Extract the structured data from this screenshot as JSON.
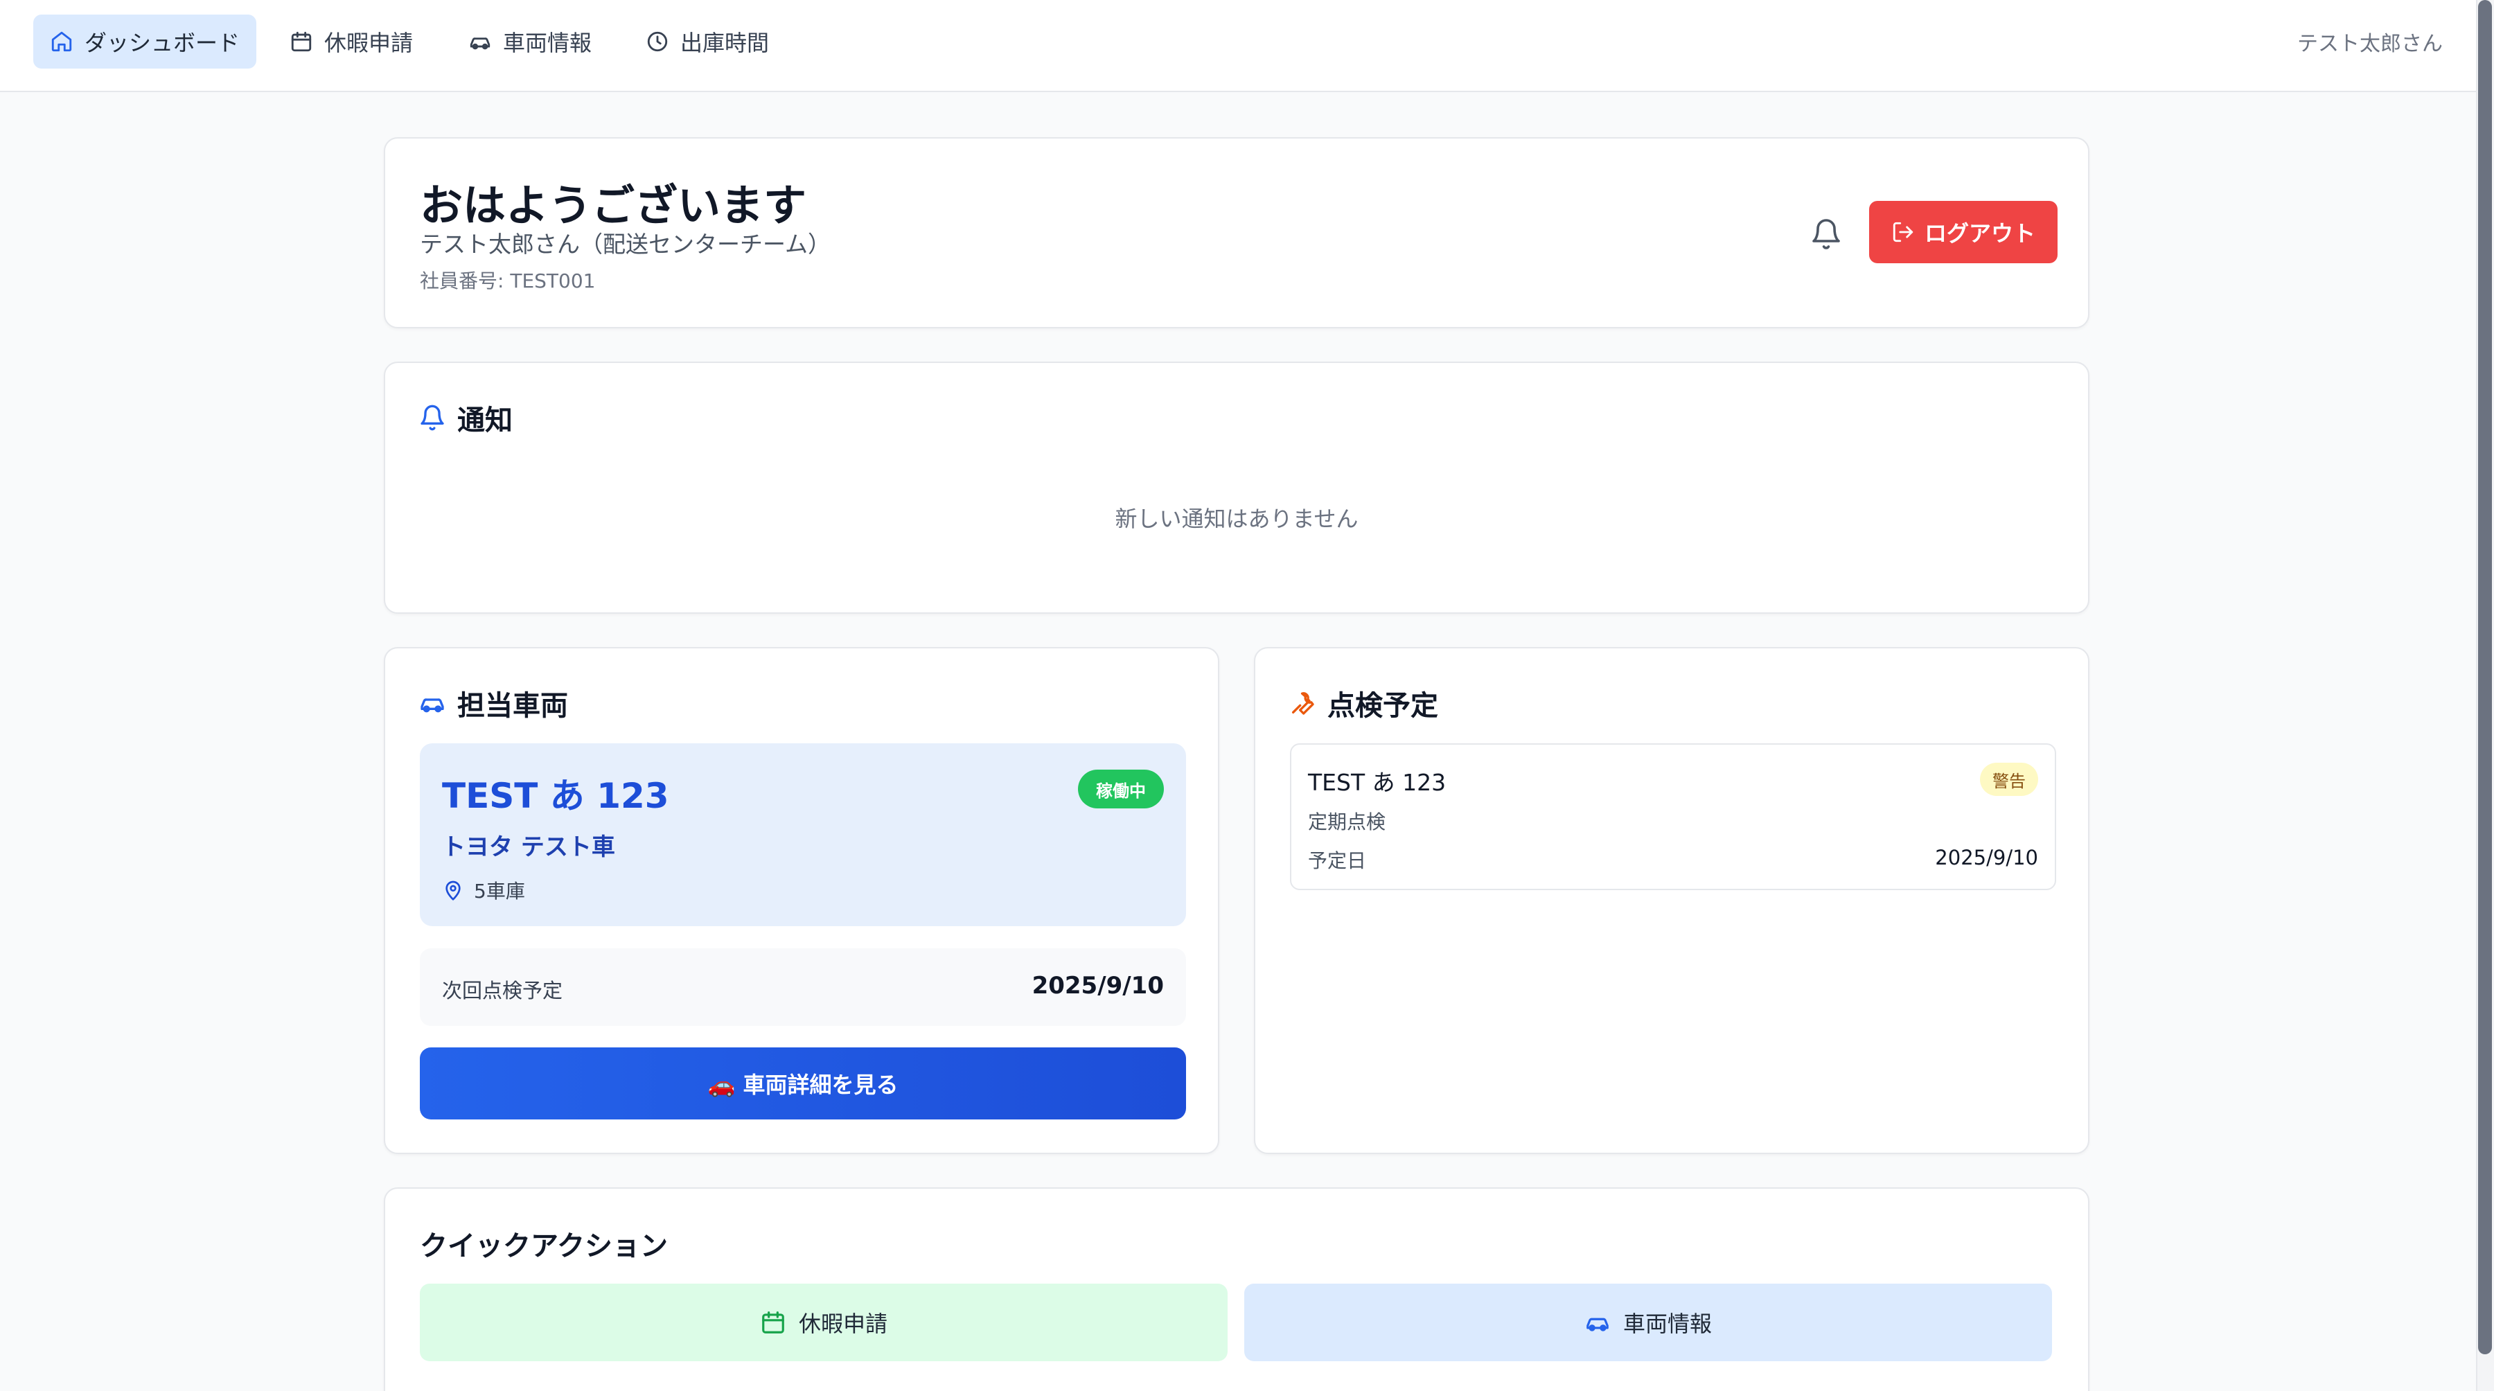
{
  "nav": {
    "items": [
      {
        "label": "ダッシュボード",
        "icon": "home-icon"
      },
      {
        "label": "休暇申請",
        "icon": "calendar-icon"
      },
      {
        "label": "車両情報",
        "icon": "car-icon"
      },
      {
        "label": "出庫時間",
        "icon": "clock-icon"
      }
    ],
    "user": "テスト太郎さん"
  },
  "greeting": {
    "title": "おはようございます",
    "subtitle": "テスト太郎さん（配送センターチーム）",
    "employee_id": "社員番号: TEST001",
    "logout_label": "ログアウト"
  },
  "notifications": {
    "title": "通知",
    "empty_message": "新しい通知はありません"
  },
  "vehicle": {
    "title": "担当車両",
    "plate": "TEST あ 123",
    "status": "稼働中",
    "model": "トヨタ テスト車",
    "garage": "5車庫",
    "next_label": "次回点検予定",
    "next_date": "2025/9/10",
    "detail_button": "🚗 車両詳細を見る"
  },
  "inspection": {
    "title": "点検予定",
    "items": [
      {
        "plate": "TEST あ 123",
        "badge": "警告",
        "type": "定期点検",
        "date_label": "予定日",
        "date": "2025/9/10"
      }
    ]
  },
  "quick_actions": {
    "title": "クイックアクション",
    "leave": "休暇申請",
    "vehicle": "車両情報"
  },
  "colors": {
    "accent": "#2563eb",
    "danger": "#ef4444",
    "success": "#22c55e",
    "warning_bg": "#fef9c3",
    "inspection_icon": "#ea580c"
  }
}
